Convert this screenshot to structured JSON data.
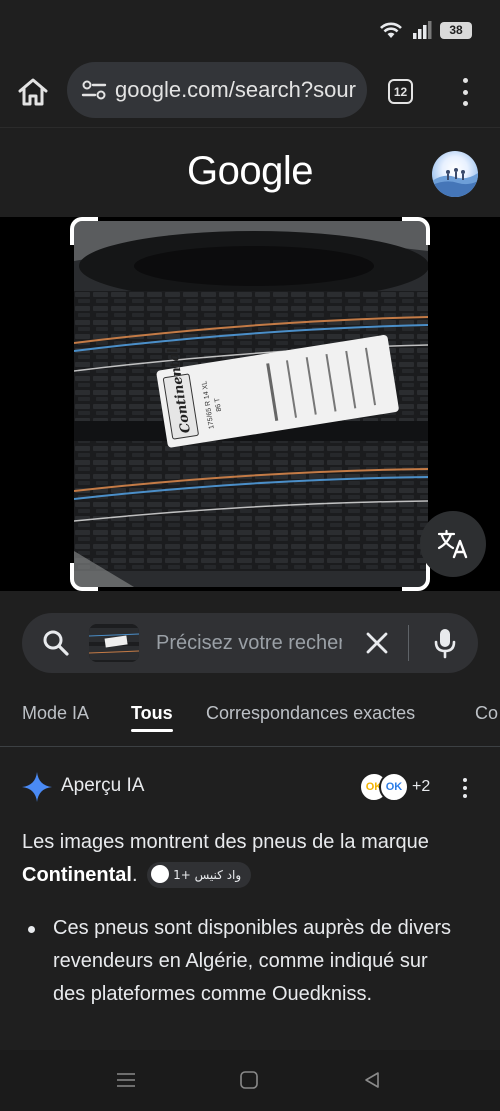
{
  "status_bar": {
    "battery_level": "38",
    "icons": [
      "wifi-icon",
      "signal-icon",
      "battery-icon"
    ]
  },
  "browser": {
    "url": "google.com/search?sour",
    "tab_count": "12",
    "icons": [
      "home-icon",
      "site-settings-icon",
      "tabs-icon",
      "more-vert-icon"
    ]
  },
  "header": {
    "logo": "Google"
  },
  "search": {
    "placeholder": "Précisez votre recherche",
    "icons": [
      "search-icon",
      "close-icon",
      "mic-icon"
    ]
  },
  "tabs": {
    "items": [
      "Mode IA",
      "Tous",
      "Correspondances exactes",
      "Co"
    ],
    "active": "Tous"
  },
  "ai_overview": {
    "title": "Aperçu IA",
    "source_count": "+2",
    "sources": [
      {
        "logo_text": "OK"
      },
      {
        "logo_text": "OK"
      }
    ],
    "intro_text": "Les images montrent des pneus de la marque",
    "brand": "Continental",
    "brand_suffix": ".",
    "chip_label": "واد كنيس +1",
    "bullets": [
      "Ces pneus sont disponibles auprès de divers revendeurs en Algérie, comme indiqué sur des plateformes comme Ouedkniss."
    ]
  },
  "photo": {
    "label_brand": "Continental",
    "label_size": "175/65 R 14 XL",
    "label_load": "86 T"
  },
  "colors": {
    "background": "#1f1f1f",
    "surface": "#303134",
    "ai_spark_blue": "#4a8af4"
  },
  "nav": {
    "icons": [
      "recents-icon",
      "home-nav-icon",
      "back-icon"
    ]
  }
}
